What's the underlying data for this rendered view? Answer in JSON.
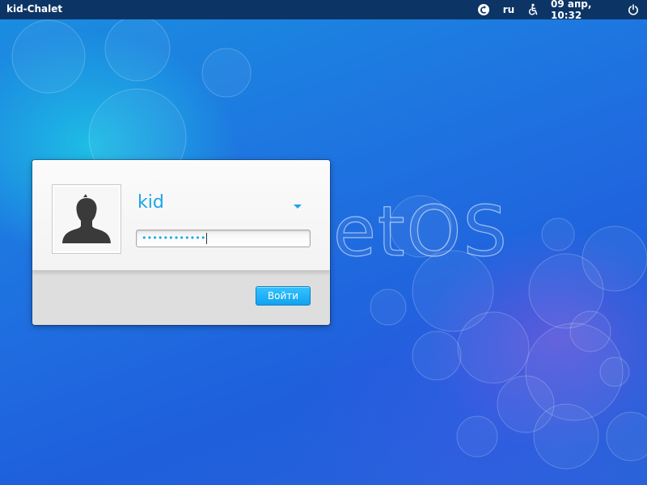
{
  "topbar": {
    "hostname": "kid-Chalet",
    "language": "ru",
    "datetime": "09 апр, 10:32",
    "icons": {
      "session": "session-icon",
      "accessibility": "accessibility-icon",
      "power": "power-icon"
    }
  },
  "background": {
    "brand_text": "etOS"
  },
  "login": {
    "username": "kid",
    "password_mask": "••••••••••••",
    "submit_label": "Войти",
    "avatar_icon": "user-avatar-icon",
    "dropdown_icon": "chevron-down-icon"
  },
  "colors": {
    "topbar": "#0c3566",
    "accent": "#1aa6e8",
    "button": "#11a3f0"
  }
}
